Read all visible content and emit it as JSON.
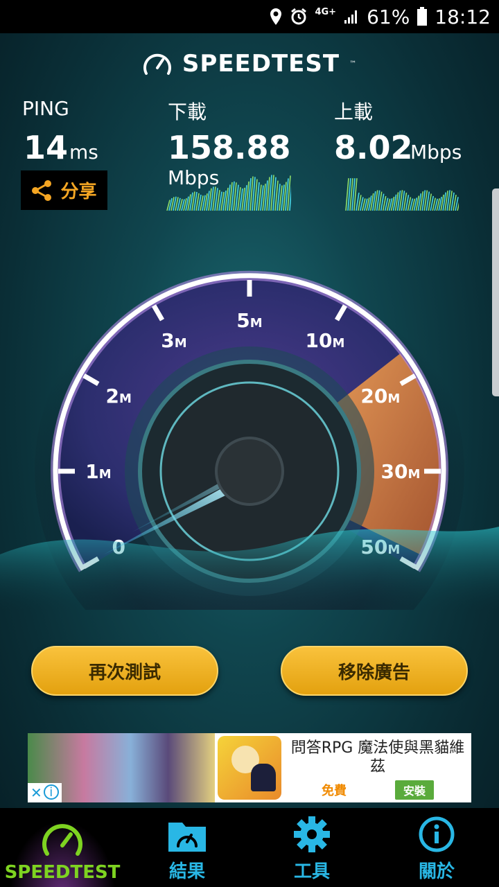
{
  "status_bar": {
    "network": "4G+",
    "battery": "61%",
    "time": "18:12"
  },
  "app": {
    "logo_text": "SPEEDTEST",
    "trademark": "™"
  },
  "results": {
    "ping": {
      "label": "PING",
      "value": "14",
      "unit": "ms"
    },
    "download": {
      "label": "下載",
      "value": "158.88",
      "unit": "Mbps"
    },
    "upload": {
      "label": "上載",
      "value": "8.02",
      "unit": "Mbps"
    },
    "share_label": "分享"
  },
  "gauge": {
    "ticks": [
      {
        "num": "0",
        "unit": ""
      },
      {
        "num": "1",
        "unit": "M"
      },
      {
        "num": "2",
        "unit": "M"
      },
      {
        "num": "3",
        "unit": "M"
      },
      {
        "num": "5",
        "unit": "M"
      },
      {
        "num": "10",
        "unit": "M"
      },
      {
        "num": "20",
        "unit": "M"
      },
      {
        "num": "30",
        "unit": "M"
      },
      {
        "num": "50",
        "unit": "M"
      }
    ],
    "colors": {
      "ring": "#b58ce8",
      "highlight": "#f08a3a",
      "needle": "#7fe3f0"
    }
  },
  "buttons": {
    "retest": "再次測試",
    "remove_ads": "移除廣告"
  },
  "ad": {
    "title": "問答RPG 魔法使與黑貓維茲",
    "price": "免費",
    "install": "安裝"
  },
  "nav": [
    {
      "label": "SPEEDTEST",
      "icon": "speedometer-icon",
      "active": true
    },
    {
      "label": "結果",
      "icon": "folder-gauge-icon",
      "active": false
    },
    {
      "label": "工具",
      "icon": "gear-icon",
      "active": false
    },
    {
      "label": "關於",
      "icon": "info-icon",
      "active": false
    }
  ]
}
